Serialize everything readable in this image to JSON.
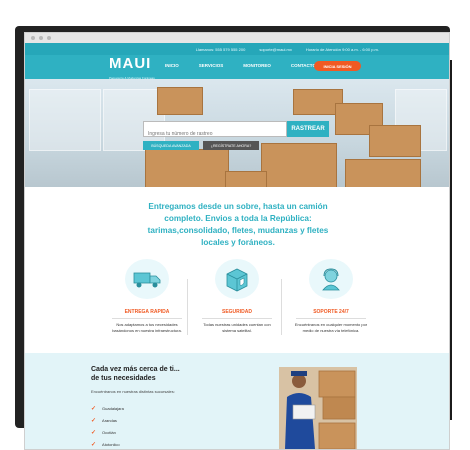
{
  "topbar": {
    "phone": "Llamanos: 555 579 555 200",
    "email": "soporte@maui.mx",
    "hours": "Horario de Atención 9:00 a.m. - 6:00 p.m."
  },
  "brand": {
    "name": "MAUI",
    "tagline": "Paquetería & Mudanzas Foráneas"
  },
  "nav": {
    "items": [
      "INICIO",
      "SERVICIOS",
      "MONITOREO",
      "CONTACTO"
    ],
    "login": "INICIA SESIÓN"
  },
  "hero": {
    "search_placeholder": "Ingresa tu número de rastreo",
    "track_button": "RASTREAR",
    "advanced_button": "BÚSQUEDA AVANZADA",
    "register_button": "¿REGÍSTRATE AHORA?"
  },
  "intro": "Entregamos desde un sobre, hasta un camión completo. Envios a toda la República: tarimas,consolidado, fletes, mudanzas y fletes locales y foráneos.",
  "features": [
    {
      "title": "ENTREGA RAPIDA",
      "desc": "Nos adaptamos a tus necesidades basándonos en nuestra infraestructura."
    },
    {
      "title": "SEGURIDAD",
      "desc": "Todas nuestras unidades cuentan con sistema satelital."
    },
    {
      "title": "SOPORTE 24/7",
      "desc": "Encuéntranos en cualquier momento por medio de nuestra vía telefónica."
    }
  ],
  "coverage": {
    "title_line1": "Cada vez más cerca de ti...",
    "title_line2": "de tus necesidades",
    "subtitle": "Encuéntranos en nuestras distintas sucursales:",
    "cities": [
      "Guadalajara",
      "Arandas",
      "Ocotlán",
      "Atotonilco"
    ]
  },
  "colors": {
    "primary": "#2fb1c2",
    "accent": "#f05a23"
  }
}
